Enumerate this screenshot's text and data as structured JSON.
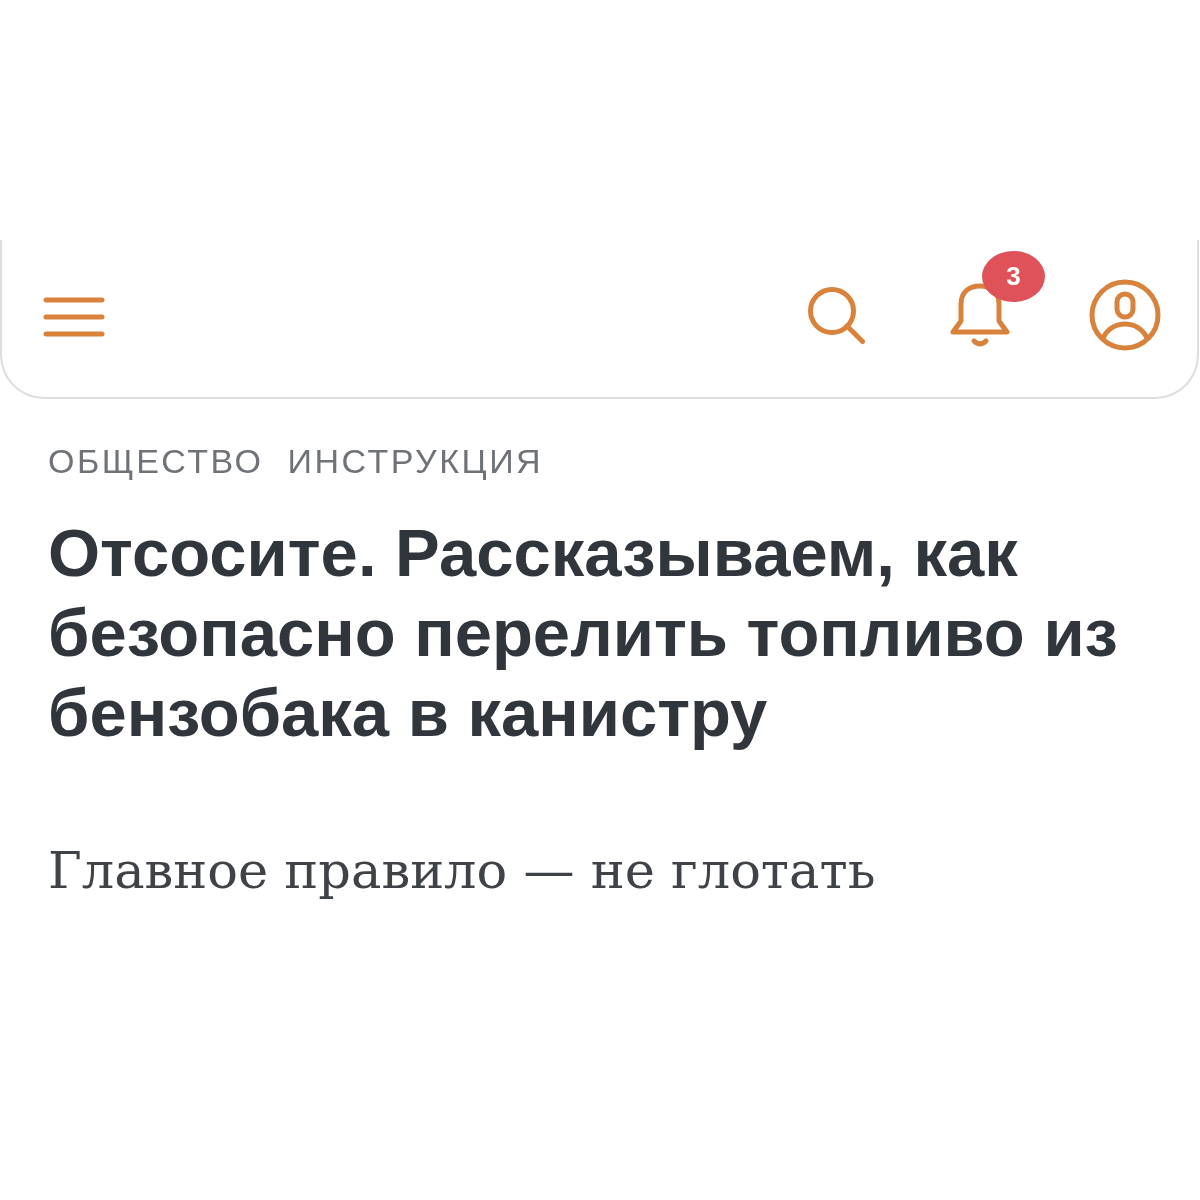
{
  "header": {
    "notifications": {
      "badge": "3"
    }
  },
  "tags": [
    "ОБЩЕСТВО",
    "ИНСТРУКЦИЯ"
  ],
  "article": {
    "title": "Отсосите. Рассказываем, как безопасно перелить топливо из бензобака в канистру",
    "subtitle": "Главное правило — не глотать"
  }
}
